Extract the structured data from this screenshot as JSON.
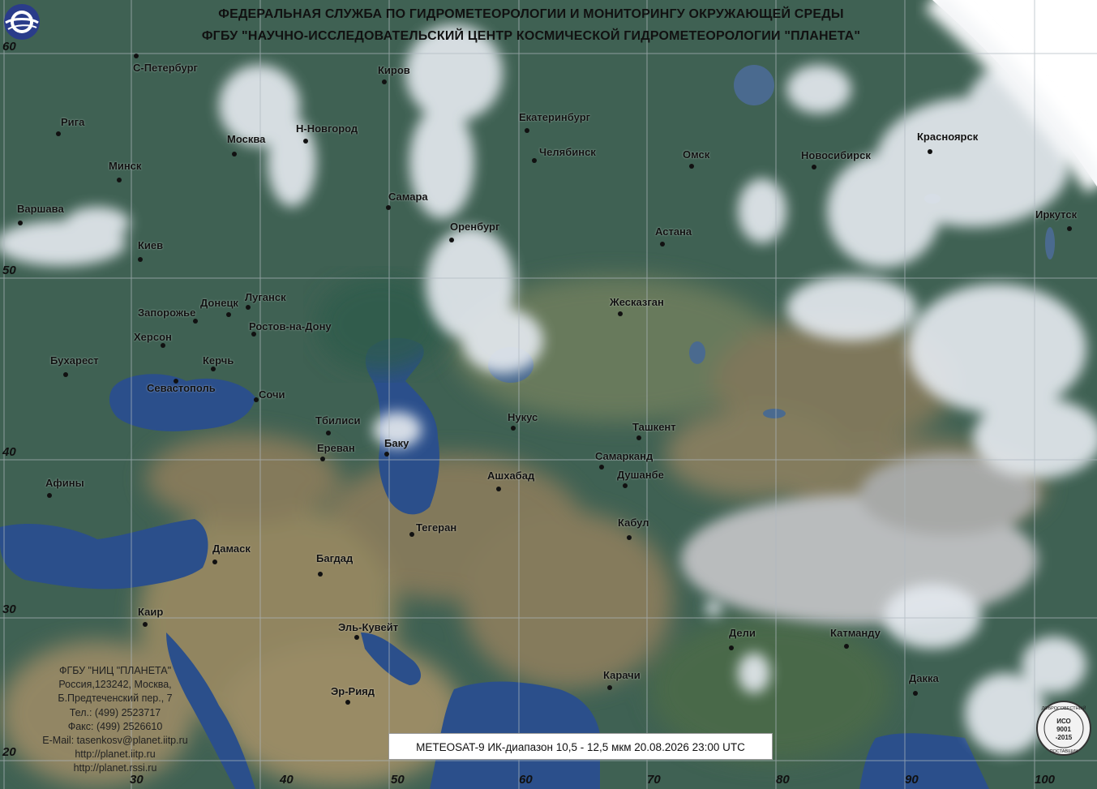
{
  "header": {
    "line1": "ФЕДЕРАЛЬНАЯ СЛУЖБА ПО ГИДРОМЕТЕОРОЛОГИИ И МОНИТОРИНГУ ОКРУЖАЮЩЕЙ СРЕДЫ",
    "line2": "ФГБУ \"НАУЧНО-ИССЛЕДОВАТЕЛЬСКИЙ ЦЕНТР КОСМИЧЕСКОЙ ГИДРОМЕТЕОРОЛОГИИ \"ПЛАНЕТА\""
  },
  "latitude_labels": [
    "60",
    "50",
    "40",
    "30",
    "20"
  ],
  "longitude_labels": [
    "30",
    "40",
    "50",
    "60",
    "70",
    "80",
    "90",
    "100"
  ],
  "cities": [
    {
      "name": "С-Петербург"
    },
    {
      "name": "Киров"
    },
    {
      "name": "Рига"
    },
    {
      "name": "Москва"
    },
    {
      "name": "Н-Новгород"
    },
    {
      "name": "Екатеринбург"
    },
    {
      "name": "Челябинск"
    },
    {
      "name": "Омск"
    },
    {
      "name": "Новосибирск"
    },
    {
      "name": "Красноярск"
    },
    {
      "name": "Минск"
    },
    {
      "name": "Самара"
    },
    {
      "name": "Варшава"
    },
    {
      "name": "Оренбург"
    },
    {
      "name": "Астана"
    },
    {
      "name": "Иркутск"
    },
    {
      "name": "Киев"
    },
    {
      "name": "Луганск"
    },
    {
      "name": "Донецк"
    },
    {
      "name": "Запорожье"
    },
    {
      "name": "Жесказган"
    },
    {
      "name": "Ростов-на-Дону"
    },
    {
      "name": "Херсон"
    },
    {
      "name": "Керчь"
    },
    {
      "name": "Бухарест"
    },
    {
      "name": "Севастополь"
    },
    {
      "name": "Сочи"
    },
    {
      "name": "Тбилиси"
    },
    {
      "name": "Нукус"
    },
    {
      "name": "Ташкент"
    },
    {
      "name": "Баку"
    },
    {
      "name": "Ереван"
    },
    {
      "name": "Самарканд"
    },
    {
      "name": "Ашхабад"
    },
    {
      "name": "Душанбе"
    },
    {
      "name": "Афины"
    },
    {
      "name": "Кабул"
    },
    {
      "name": "Тегеран"
    },
    {
      "name": "Дамаск"
    },
    {
      "name": "Багдад"
    },
    {
      "name": "Каир"
    },
    {
      "name": "Эль-Кувейт"
    },
    {
      "name": "Дели"
    },
    {
      "name": "Катманду"
    },
    {
      "name": "Карачи"
    },
    {
      "name": "Дакка"
    },
    {
      "name": "Эр-Рияд"
    }
  ],
  "contact": [
    "ФГБУ \"НИЦ \"ПЛАНЕТА\"",
    "Россия,123242, Москва,",
    "Б.Предтеченский пер., 7",
    "Тел.:  (499) 2523717",
    "Факс: (499) 2526610",
    "E-Mail: tasenkosv@planet.iitp.ru",
    "http://planet.iitp.ru",
    "http://planet.rssi.ru"
  ],
  "caption": "METEOSAT-9   ИК-диапазон 10,5 - 12,5 мкм   20.08.2026  23:00 UTC",
  "iso_badge": {
    "top": "ДОБРОСОВЕСТНЫЙ",
    "line1": "ИСО",
    "line2": "9001",
    "line3": "-2015",
    "bottom": "ПОСТАВЩИК"
  },
  "colors": {
    "land": "#3d5e52",
    "sea": "#2a4e8a",
    "cloud": "#dfe6ec",
    "desert": "#8c7f5e"
  }
}
